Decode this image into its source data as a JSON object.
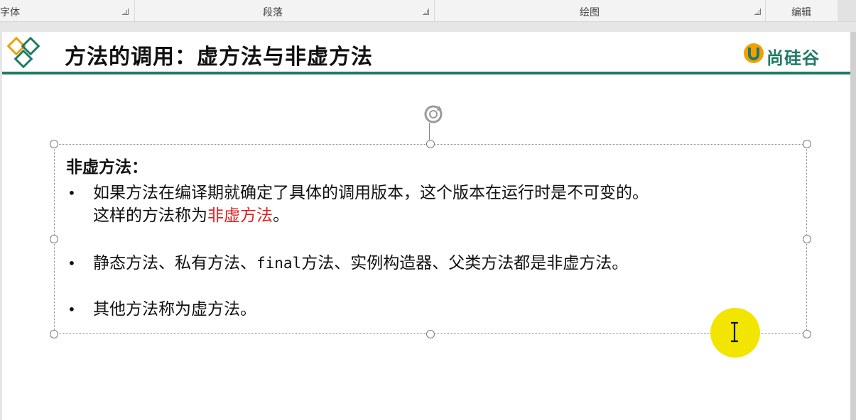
{
  "ribbon": {
    "groups": [
      {
        "label": "字体"
      },
      {
        "label": "段落"
      },
      {
        "label": "绘图"
      },
      {
        "label": "编辑"
      }
    ]
  },
  "slide": {
    "title": "方法的调用：虚方法与非虚方法",
    "brand_name": "尚硅谷",
    "colors": {
      "accent": "#1f7a66",
      "logo_orange": "#f0a000",
      "highlight_red": "#e02020",
      "cursor_yellow": "#f2e600"
    },
    "textbox": {
      "heading": "非虚方法：",
      "bullets": [
        {
          "line1": "如果方法在编译期就确定了具体的调用版本，这个版本在运行时是不可变的。",
          "line2_prefix": "这样的方法称为",
          "line2_highlight": "非虚方法",
          "line2_suffix": "。"
        },
        {
          "text_a": "静态方法、私有方法、",
          "text_mono": "final",
          "text_b": "方法、实例构造器、父类方法都是非虚方法。"
        },
        {
          "text": "其他方法称为虚方法。"
        }
      ]
    }
  },
  "icons": {
    "logo": "diamond-logo-icon",
    "rotate": "rotate-handle-icon",
    "cursor": "ibeam-cursor-icon",
    "launcher": "dialog-launcher-icon"
  }
}
